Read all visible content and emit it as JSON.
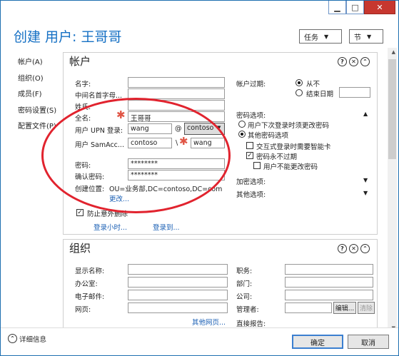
{
  "window": {
    "title": "创建 用户: 王哥哥",
    "minimize": "▁",
    "maximize": "□",
    "close": "✕"
  },
  "toolbar": {
    "tasks": "任务",
    "sections": "节"
  },
  "nav": [
    "帐户(A)",
    "组织(O)",
    "成员(F)",
    "密码设置(S)",
    "配置文件(P)"
  ],
  "account": {
    "heading": "帐户",
    "labels": {
      "first_name": "名字:",
      "initials": "中间名首字母...",
      "last_name": "姓氏:",
      "full_name": "全名:",
      "upn": "用户 UPN 登录:",
      "sam": "用户 SamAcc...",
      "password": "密码:",
      "confirm": "确认密码:",
      "create_in": "创建位置:"
    },
    "values": {
      "full_name": "王哥哥",
      "upn_user": "wang",
      "at": "@",
      "upn_domain": "contoso",
      "sam_domain": "contoso",
      "backslash": "\\",
      "sam_user": "wang",
      "password": "********",
      "confirm": "********",
      "create_in": "OU=业务部,DC=contoso,DC=com"
    },
    "more_link": "更改...",
    "protect": "防止意外删除",
    "logon_hours": "登录小时...",
    "logon_to": "登录到...",
    "expiry_label": "帐户过期:",
    "never": "从不",
    "end_date": "结束日期",
    "pwd_options": "密码选项:",
    "must_change": "用户下次登录时须更改密码",
    "other_options": "其他密码选项",
    "smartcard": "交互式登录时需要智能卡",
    "never_expires": "密码永不过期",
    "cannot_change": "用户不能更改密码",
    "encryption": "加密选项:",
    "other": "其他选项:"
  },
  "org": {
    "heading": "组织",
    "display_name": "显示名称:",
    "office": "办公室:",
    "email": "电子邮件:",
    "web": "网页:",
    "other_web": "其他网页...",
    "title": "职务:",
    "dept": "部门:",
    "company": "公司:",
    "manager": "管理者:",
    "edit": "编辑...",
    "clear": "清除",
    "direct_reports": "直接报告:"
  },
  "footer": {
    "details": "详细信息",
    "ok": "确定",
    "cancel": "取消"
  },
  "icons": {
    "help": "?",
    "close": "✕",
    "collapse": "⌃",
    "star": "✱",
    "up": "▲",
    "down": "▼"
  }
}
